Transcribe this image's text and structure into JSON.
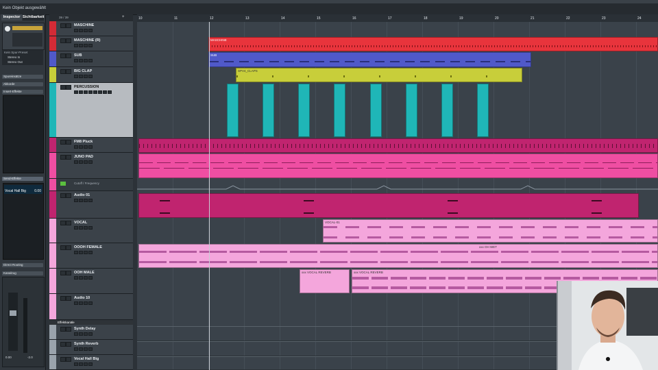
{
  "window": {
    "status": "Kein Objekt ausgewählt"
  },
  "inspector": {
    "tabs": [
      "Inspector",
      "Sichtbarkeit"
    ],
    "routing": {
      "input": "Kein Spur-Preset",
      "in": "Stereo In",
      "out": "Stereo Out"
    },
    "sections": [
      "Spureinsätze",
      "Akkorde",
      "Insert-Effekte",
      "Send-Effekte",
      "Direct Routing",
      "Kanalzug"
    ],
    "send": {
      "name": "Vocal Hall Big",
      "value": "0.00"
    },
    "fader": {
      "left": "0.00",
      "right": "-2.0"
    }
  },
  "tracklist": {
    "header": "39 / 39",
    "tracks": [
      {
        "name": "MASCHINE",
        "color": "#d42b36"
      },
      {
        "name": "MASCHINE (R)",
        "color": "#d42b36"
      },
      {
        "name": "SUB",
        "color": "#5059c9"
      },
      {
        "name": "BIG CLAP",
        "color": "#c8ce3a"
      },
      {
        "name": "PERCUSSION",
        "color": "#1fb6b7"
      },
      {
        "name": "FM8 Pluck",
        "color": "#c0246f"
      },
      {
        "name": "JUNO PAD",
        "color": "#ef4ea2"
      },
      {
        "name": "Audio 01",
        "color": "#c0246f"
      },
      {
        "name": "VOCAL",
        "color": "#f4a6dc"
      },
      {
        "name": "OOOH FEMALE",
        "color": "#f4a6dc"
      },
      {
        "name": "OOH MALE",
        "color": "#f4a6dc"
      },
      {
        "name": "Audio 10",
        "color": "#f4a6dc"
      }
    ],
    "automation": "Cutoff / Frequency",
    "fx_folder": "Effektkanäle",
    "fx_tracks": [
      "Synth Delay",
      "Synth Reverb",
      "Vocal Hall Big"
    ]
  },
  "ruler": {
    "bars": [
      "10",
      "11",
      "12",
      "13",
      "14",
      "15",
      "16",
      "17",
      "18",
      "19",
      "20",
      "21",
      "22",
      "23",
      "24"
    ]
  },
  "parts": {
    "maschine": "MASCHINE",
    "sub": "SUB",
    "clap": "SPV4_CLAPS",
    "vocal": "VOCAL-01",
    "ooh_wet": "xxx OH WET",
    "vocal_reverb": "xxx VOCAL REVERB"
  },
  "colors": {
    "accent": "#1fb6b7",
    "maschine": "#e8343c",
    "sub": "#5059c9",
    "clap": "#c8ce3a",
    "perc": "#1fb6b7",
    "fm8": "#c0246f",
    "juno": "#ef4ea2",
    "vocal": "#f4a6dc"
  }
}
